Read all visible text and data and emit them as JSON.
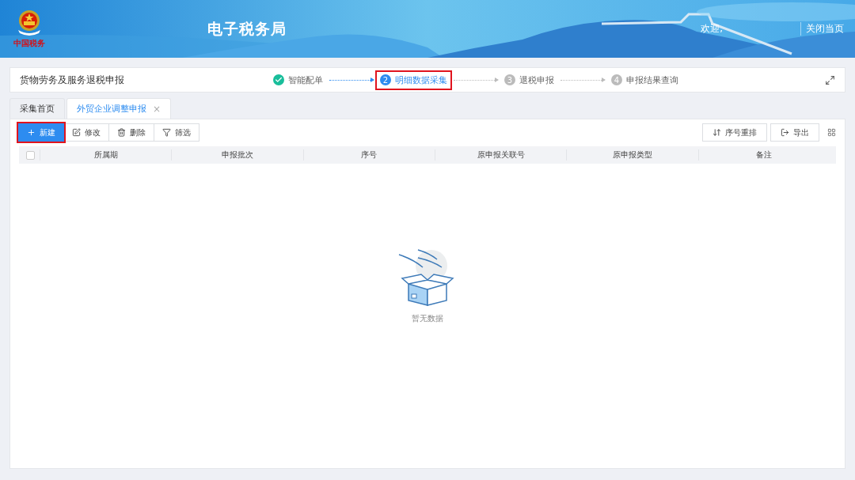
{
  "header": {
    "logo_text": "中国税务",
    "title": "电子税务局",
    "welcome": "欢迎,",
    "close_page": "关闭当页"
  },
  "steps_bar": {
    "title": "货物劳务及服务退税申报",
    "steps": [
      {
        "label": "智能配单",
        "completed": true,
        "selected": false,
        "highlighted": false
      },
      {
        "number": "2",
        "label": "明细数据采集",
        "completed": false,
        "selected": true,
        "highlighted": true
      },
      {
        "number": "3",
        "label": "退税申报",
        "completed": false,
        "selected": false,
        "highlighted": false
      },
      {
        "number": "4",
        "label": "申报结果查询",
        "completed": false,
        "selected": false,
        "highlighted": false
      }
    ]
  },
  "tabs": [
    {
      "label": "采集首页",
      "selected": false,
      "closable": false
    },
    {
      "label": "外贸企业调整申报",
      "selected": true,
      "closable": true,
      "close": "×"
    }
  ],
  "toolbar": {
    "left": [
      {
        "kind": "add",
        "label": "新建",
        "primary": true,
        "highlighted": true
      },
      {
        "kind": "edit",
        "label": "修改",
        "primary": false,
        "highlighted": false
      },
      {
        "kind": "delete",
        "label": "删除",
        "primary": false,
        "highlighted": false
      },
      {
        "kind": "filter",
        "label": "筛选",
        "primary": false,
        "highlighted": false
      }
    ],
    "right": [
      {
        "kind": "sort",
        "label": "序号重排"
      },
      {
        "kind": "export",
        "label": "导出"
      }
    ]
  },
  "table": {
    "select_all_checked": false,
    "columns": [
      "所属期",
      "申报批次",
      "序号",
      "原申报关联号",
      "原申报类型",
      "备注"
    ]
  },
  "empty_state": {
    "text": "暂无数据"
  }
}
